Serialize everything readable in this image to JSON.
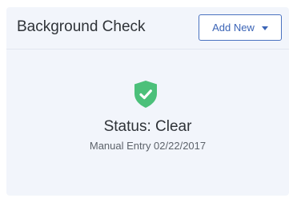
{
  "card": {
    "title": "Background Check",
    "add_button_label": "Add New"
  },
  "status": {
    "icon": "shield-check-icon",
    "text": "Status: Clear",
    "entry": "Manual Entry 02/22/2017"
  },
  "colors": {
    "accent": "#3b64b6",
    "success": "#4cc07a",
    "card_bg": "#f2f5fb"
  }
}
